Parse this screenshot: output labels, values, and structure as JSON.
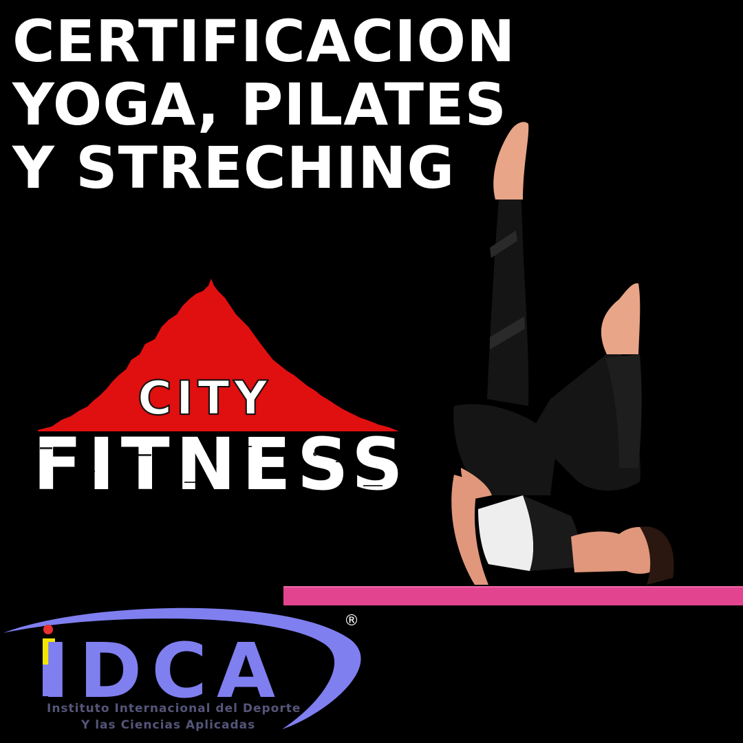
{
  "headline": {
    "lines": [
      "CERTIFICACION",
      "YOGA, PILATES",
      "Y STRECHING"
    ]
  },
  "city_fitness_logo": {
    "word1": "CITY",
    "word2": "FITNESS"
  },
  "idca_logo": {
    "acronym": "IDCA",
    "registered_mark": "®",
    "line1": "Instituto Internacional del Deporte",
    "line2": "Y las Ciencias Aplicadas"
  },
  "colors": {
    "background": "#000000",
    "headline": "#ffffff",
    "city_red": "#e01010",
    "mat_pink": "#e2448f",
    "idca_blue": "#7f7ff0",
    "idca_yellow": "#f2e600",
    "idca_red": "#e83030"
  }
}
